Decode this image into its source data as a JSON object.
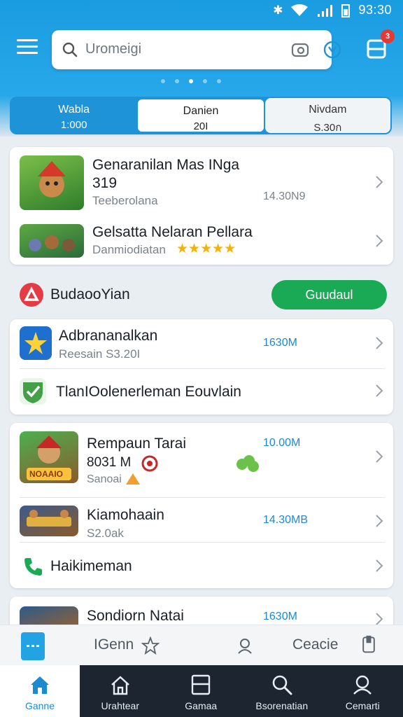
{
  "status": {
    "time": "93:30"
  },
  "search": {
    "placeholder": "Uromeigi"
  },
  "cart": {
    "badge": "3"
  },
  "tabs": [
    {
      "label": "Wabla",
      "value": "1:000"
    },
    {
      "label": "Danien",
      "value": "20I"
    },
    {
      "label": "Nivdam",
      "value": "S.30ก"
    }
  ],
  "featured": [
    {
      "title": "Genaranilan Mas INga",
      "line2": "319",
      "sub": "Teeberolana",
      "size": "14.30N9"
    },
    {
      "title": "Gelsatta Nelaran Pellara",
      "sub": "Danmiodiatan",
      "rating": "★★★★★"
    }
  ],
  "section": {
    "title": "BudaooYian",
    "button": "Guudaul"
  },
  "list1": [
    {
      "title": "Adbrananalkan",
      "sub": "Reesain S3.20I",
      "size": "1630M"
    },
    {
      "title": "TlanIOolenerleman Eouvlain"
    }
  ],
  "list2": [
    {
      "title": "Rempaun Tarai",
      "line2": "8031 M",
      "sub": "Sanoai",
      "size": "10.00M",
      "badge": "NOAAIO"
    },
    {
      "title": "Kiamohaain",
      "sub": "S2.0ak",
      "size": "14.30MB"
    },
    {
      "title": "Haikimeman"
    }
  ],
  "partial": {
    "title": "Sondiorn Natai",
    "size": "1630M"
  },
  "toolbar": {
    "left_label": "IGenn",
    "right_label": "Ceacie"
  },
  "nav": [
    {
      "label": "Ganne"
    },
    {
      "label": "Urahtear"
    },
    {
      "label": "Gamaa"
    },
    {
      "label": "Bsorenatian"
    },
    {
      "label": "Cemarti"
    }
  ],
  "colors": {
    "brand_blue": "#1a9ce0",
    "accent_green": "#1aa955",
    "badge_red": "#e53935",
    "nav_dark": "#1c2530"
  }
}
